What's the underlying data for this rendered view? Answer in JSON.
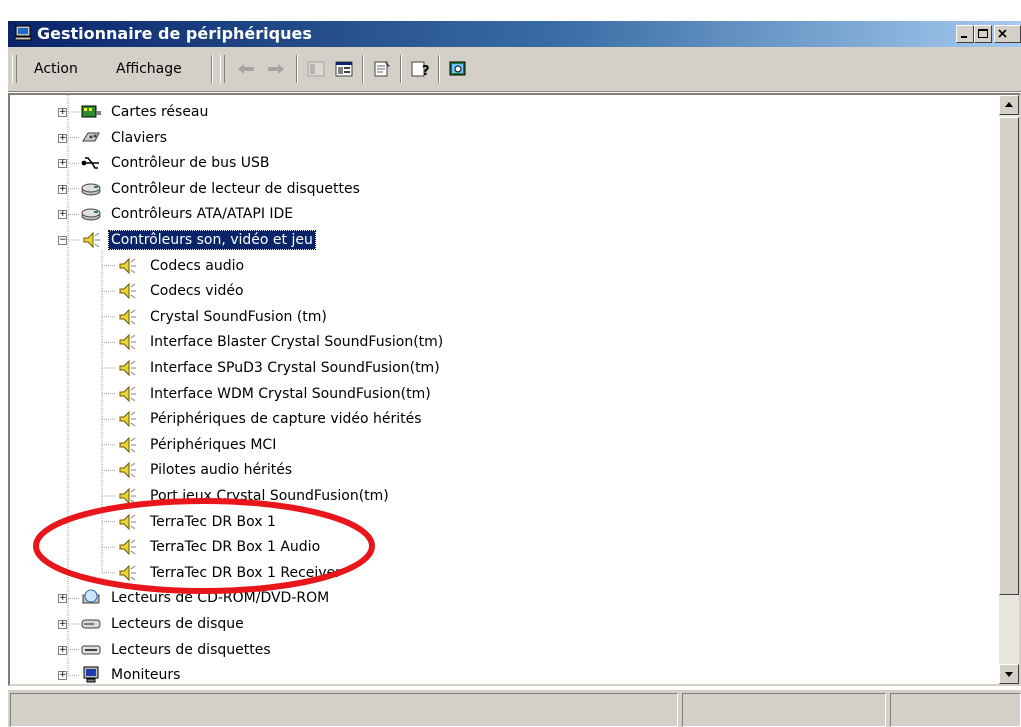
{
  "window": {
    "title": "Gestionnaire de périphériques",
    "controls": [
      "minimize-icon",
      "maximize-icon",
      "close-icon"
    ]
  },
  "menu": {
    "action": "Action",
    "view": "Affichage"
  },
  "toolbar": [
    "back-arrow-icon",
    "forward-arrow-icon",
    "tree-view-icon",
    "detail-view-icon",
    "properties-icon",
    "help-icon",
    "scan-hardware-icon"
  ],
  "tree": {
    "categories_top": [
      {
        "label": "Cartes réseau",
        "icon": "network-card-icon"
      },
      {
        "label": "Claviers",
        "icon": "keyboard-icon"
      },
      {
        "label": "Contrôleur de bus USB",
        "icon": "usb-icon"
      },
      {
        "label": "Contrôleur de lecteur de disquettes",
        "icon": "floppy-controller-icon"
      },
      {
        "label": "Contrôleurs ATA/ATAPI IDE",
        "icon": "ide-controller-icon"
      }
    ],
    "expanded": {
      "label": "Contrôleurs son, vidéo et jeu",
      "icon": "speaker-icon",
      "selected": true,
      "children": [
        "Codecs audio",
        "Codecs vidéo",
        "Crystal SoundFusion (tm)",
        "Interface Blaster Crystal SoundFusion(tm)",
        "Interface SPuD3 Crystal SoundFusion(tm)",
        "Interface WDM Crystal SoundFusion(tm)",
        "Périphériques de capture vidéo hérités",
        "Périphériques MCI",
        "Pilotes audio hérités",
        "Port jeux Crystal SoundFusion(tm)",
        "TerraTec DR Box 1",
        "TerraTec DR Box 1 Audio",
        "TerraTec DR Box 1 Receiver"
      ]
    },
    "categories_bottom": [
      {
        "label": "Lecteurs de CD-ROM/DVD-ROM",
        "icon": "cdrom-icon"
      },
      {
        "label": "Lecteurs de disque",
        "icon": "disk-drive-icon"
      },
      {
        "label": "Lecteurs de disquettes",
        "icon": "floppy-drive-icon"
      },
      {
        "label": "Moniteurs",
        "icon": "monitor-icon"
      }
    ]
  },
  "annotation": {
    "color": "#e8161b",
    "target": "TerraTec DR Box 1 devices"
  },
  "colors": {
    "titlebar": "#0a246a",
    "selection": "#0a246a",
    "chrome": "#d4d0c8"
  }
}
